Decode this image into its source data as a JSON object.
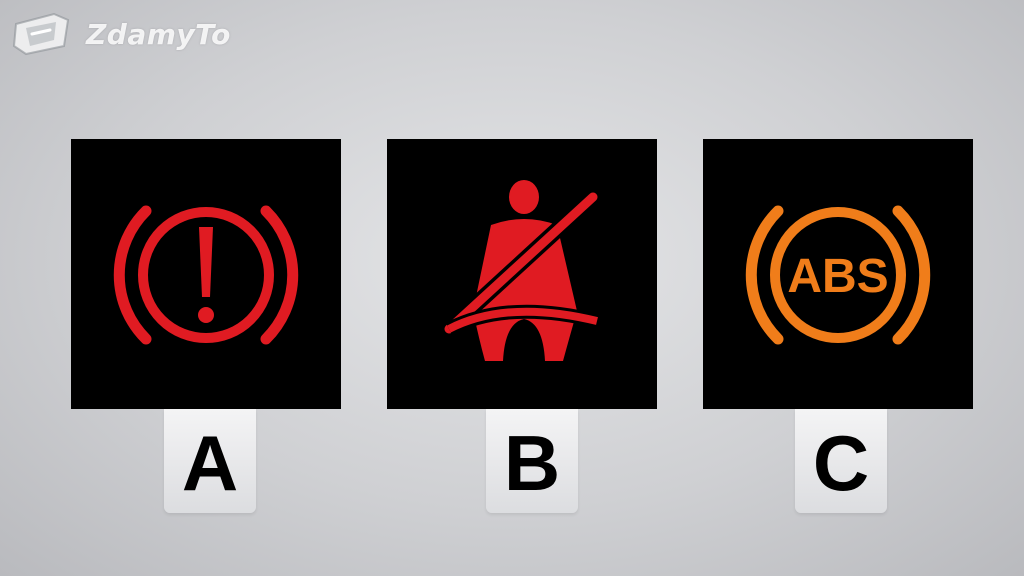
{
  "brand": {
    "name": "ZdamyTo"
  },
  "options": [
    {
      "letter": "A",
      "icon": "brake-warning-icon",
      "color": "#e01b22"
    },
    {
      "letter": "B",
      "icon": "seatbelt-warning-icon",
      "color": "#e01b22"
    },
    {
      "letter": "C",
      "icon": "abs-warning-icon",
      "color": "#f07d1a",
      "icon_text": "ABS"
    }
  ]
}
